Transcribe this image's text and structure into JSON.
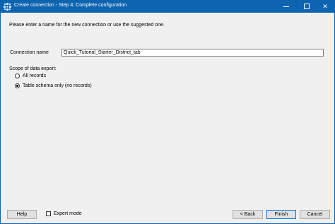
{
  "window": {
    "title": "Create connection - Step 4: Complete configuration",
    "min_label": "—",
    "close_label": "✕"
  },
  "intro_text": "Please enter a name for the new connection or use the suggested one.",
  "connection": {
    "label": "Connection name",
    "value": "Quick_Tutorial_Starter_District_tab"
  },
  "scope": {
    "label": "Scope of data export:",
    "options": [
      {
        "label": "All records",
        "checked": false
      },
      {
        "label": "Table schema only (no records)",
        "checked": true
      }
    ]
  },
  "footer": {
    "help_label": "Help",
    "expert_mode_label": "Expert mode",
    "back_label": "< Back",
    "finish_label": "Finish",
    "cancel_label": "Cancel"
  },
  "colors": {
    "titlebar": "#0f64b0",
    "dialog_bg": "#f0f0f0"
  },
  "icons": [
    "app-icon",
    "minimize-icon",
    "maximize-icon",
    "close-icon"
  ]
}
